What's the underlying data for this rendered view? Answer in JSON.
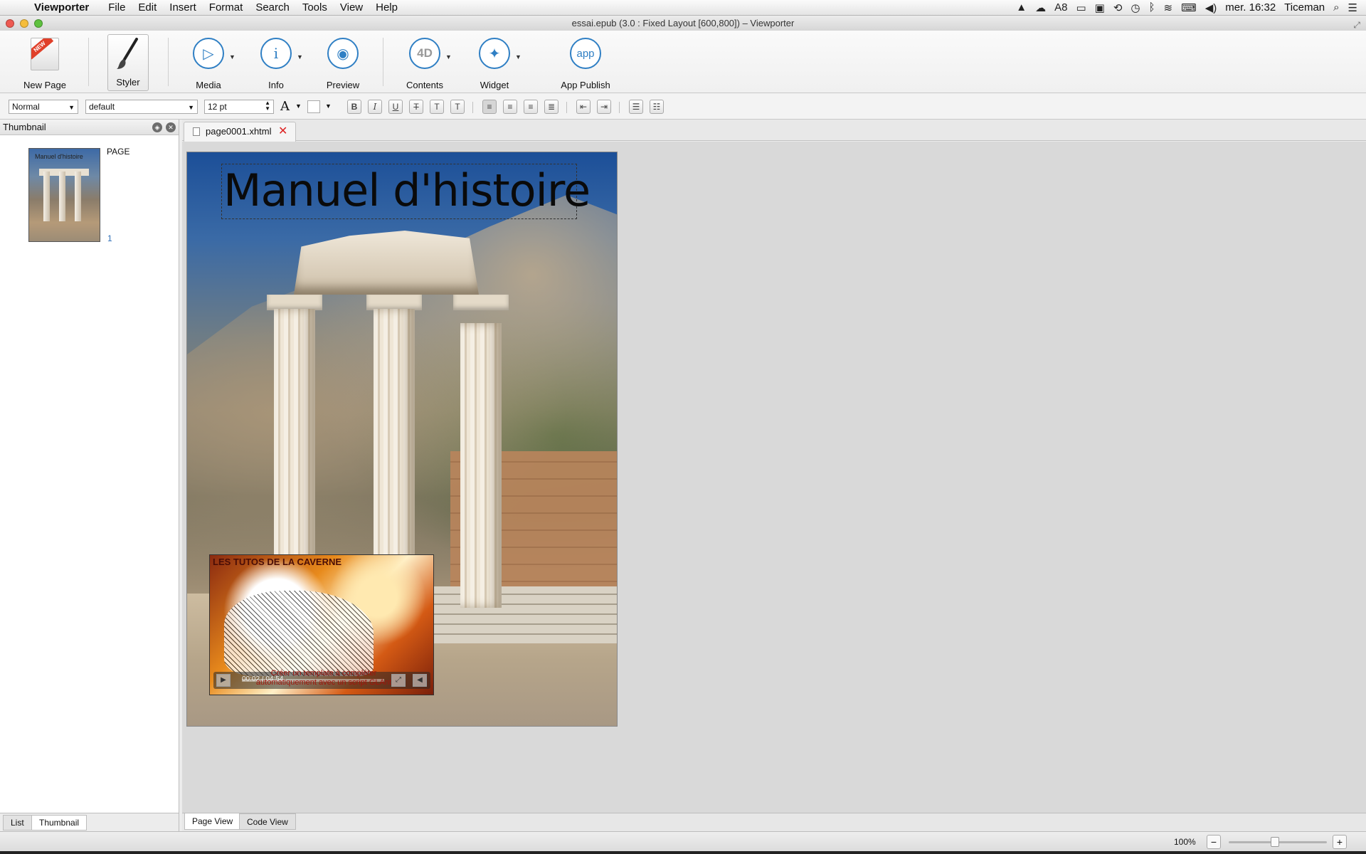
{
  "menubar": {
    "app_name": "Viewporter",
    "items": [
      "File",
      "Edit",
      "Insert",
      "Format",
      "Search",
      "Tools",
      "View",
      "Help"
    ],
    "status": {
      "adobe_count": "8",
      "clock": "mer. 16:32",
      "user": "Ticeman"
    }
  },
  "window": {
    "title": "essai.epub (3.0 : Fixed Layout [600,800]) – Viewporter"
  },
  "toolbar": {
    "new_page": "New Page",
    "new_page_ribbon": "NEW",
    "styler": "Styler",
    "media": "Media",
    "info": "Info",
    "preview": "Preview",
    "contents": "Contents",
    "contents_icon_text": "4D",
    "widget": "Widget",
    "app_publish": "App Publish",
    "app_icon_text": "app"
  },
  "formatbar": {
    "paragraph_style": "Normal",
    "font_family": "default",
    "font_size": "12 pt",
    "font_color_glyph": "A",
    "bold": "B",
    "italic": "I",
    "underline": "U",
    "strike": "T",
    "subscript": "T",
    "superscript": "T"
  },
  "left_panel": {
    "title": "Thumbnail",
    "thumbnail_label": "PAGE",
    "thumbnail_number": "1",
    "thumbnail_caption": "Manuel d'histoire",
    "tabs": [
      "List",
      "Thumbnail"
    ],
    "active_tab": "Thumbnail"
  },
  "document": {
    "tab_name": "page0001.xhtml",
    "page_title": "Manuel d'histoire",
    "video": {
      "title": "LES TUTOS DE LA CAVERNE",
      "caption_line1": "Créer un template à compléter",
      "caption_line2": "automatiquement avec un script GLAnt",
      "time": "00:02 / 04:54"
    }
  },
  "view_tabs": [
    "Page View",
    "Code View"
  ],
  "active_view": "Page View",
  "status": {
    "zoom": "100%",
    "zoom_out": "−",
    "zoom_in": "+",
    "zoom_level": 0.47
  },
  "colors": {
    "accent": "#2f7fc4",
    "tab_close": "#dd2222"
  }
}
